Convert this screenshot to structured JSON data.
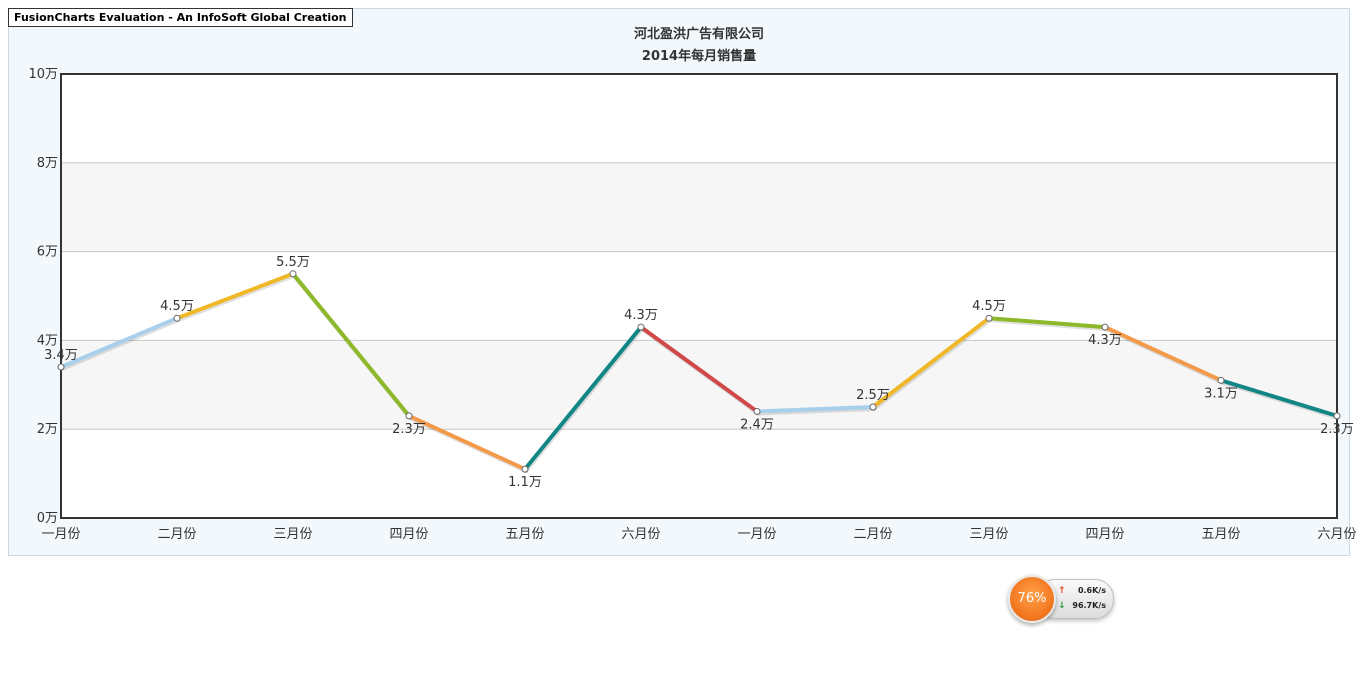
{
  "banner": {
    "text": "FusionCharts Evaluation - An InfoSoft Global Creation"
  },
  "chart_data": {
    "type": "line",
    "title": "河北盈洪广告有限公司",
    "subtitle": "2014年每月销售量",
    "xlabel": "",
    "ylabel": "",
    "categories": [
      "一月份",
      "二月份",
      "三月份",
      "四月份",
      "五月份",
      "六月份",
      "一月份",
      "二月份",
      "三月份",
      "四月份",
      "五月份",
      "六月份"
    ],
    "values": [
      34000,
      45000,
      55000,
      23000,
      11000,
      43000,
      24000,
      25000,
      45000,
      43000,
      31000,
      23000
    ],
    "value_labels": [
      "3.4万",
      "4.5万",
      "5.5万",
      "2.3万",
      "1.1万",
      "4.3万",
      "2.4万",
      "2.5万",
      "4.5万",
      "4.3万",
      "3.1万",
      "2.3万"
    ],
    "label_position": [
      "above",
      "above",
      "above",
      "below",
      "below",
      "above",
      "below",
      "above",
      "above",
      "below",
      "below",
      "below"
    ],
    "segment_colors": [
      "#a8d0ec",
      "#f0b828",
      "#8db82a",
      "#f39a4a",
      "#128585",
      "#d04848",
      "#a8d0ec",
      "#f0b828",
      "#8db82a",
      "#f39a4a",
      "#128585"
    ],
    "ylim": [
      0,
      100000
    ],
    "y_ticks": [
      0,
      20000,
      40000,
      60000,
      80000,
      100000
    ],
    "y_tick_labels": [
      "0万",
      "2万",
      "4万",
      "6万",
      "8万",
      "10万"
    ],
    "grid": true,
    "alternate_band_color": "#f6f6f6",
    "legend": "none"
  },
  "speed_widget": {
    "percent": "76%",
    "upload": "0.6K/s",
    "download": "96.7K/s",
    "up_arrow": "↑",
    "down_arrow": "↓",
    "circle_color": "#f2761e"
  }
}
